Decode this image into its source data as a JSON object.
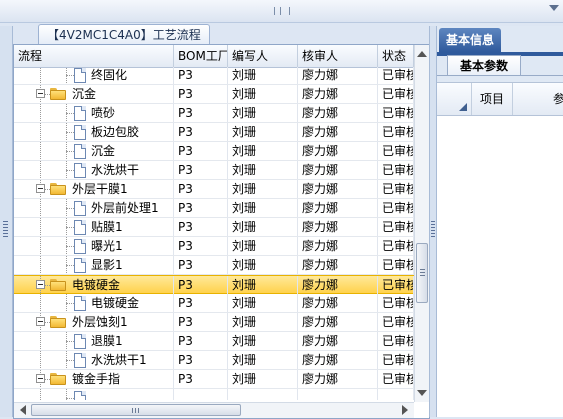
{
  "tab_caption": "【4V2MC1C4A0】工艺流程",
  "columns": [
    "流程",
    "BOM工厂",
    "编写人",
    "核审人",
    "状态"
  ],
  "rows": [
    {
      "level": 2,
      "type": "doc",
      "name": "终固化",
      "bom": "P3",
      "writer": "刘珊",
      "reviewer": "廖力娜",
      "status": "已审核"
    },
    {
      "level": 1,
      "type": "folder",
      "name": "沉金",
      "bom": "P3",
      "writer": "刘珊",
      "reviewer": "廖力娜",
      "status": "已审核"
    },
    {
      "level": 2,
      "type": "doc",
      "name": "喷砂",
      "bom": "P3",
      "writer": "刘珊",
      "reviewer": "廖力娜",
      "status": "已审核"
    },
    {
      "level": 2,
      "type": "doc",
      "name": "板边包胶",
      "bom": "P3",
      "writer": "刘珊",
      "reviewer": "廖力娜",
      "status": "已审核"
    },
    {
      "level": 2,
      "type": "doc",
      "name": "沉金",
      "bom": "P3",
      "writer": "刘珊",
      "reviewer": "廖力娜",
      "status": "已审核"
    },
    {
      "level": 2,
      "type": "doc",
      "name": "水洗烘干",
      "bom": "P3",
      "writer": "刘珊",
      "reviewer": "廖力娜",
      "status": "已审核"
    },
    {
      "level": 1,
      "type": "folder",
      "name": "外层干膜1",
      "bom": "P3",
      "writer": "刘珊",
      "reviewer": "廖力娜",
      "status": "已审核"
    },
    {
      "level": 2,
      "type": "doc",
      "name": "外层前处理1",
      "bom": "P3",
      "writer": "刘珊",
      "reviewer": "廖力娜",
      "status": "已审核"
    },
    {
      "level": 2,
      "type": "doc",
      "name": "贴膜1",
      "bom": "P3",
      "writer": "刘珊",
      "reviewer": "廖力娜",
      "status": "已审核"
    },
    {
      "level": 2,
      "type": "doc",
      "name": "曝光1",
      "bom": "P3",
      "writer": "刘珊",
      "reviewer": "廖力娜",
      "status": "已审核"
    },
    {
      "level": 2,
      "type": "doc",
      "name": "显影1",
      "bom": "P3",
      "writer": "刘珊",
      "reviewer": "廖力娜",
      "status": "已审核"
    },
    {
      "level": 1,
      "type": "folder",
      "name": "电镀硬金",
      "bom": "P3",
      "writer": "刘珊",
      "reviewer": "廖力娜",
      "status": "已审核",
      "selected": true
    },
    {
      "level": 2,
      "type": "doc",
      "name": "电镀硬金",
      "bom": "P3",
      "writer": "刘珊",
      "reviewer": "廖力娜",
      "status": "已审核"
    },
    {
      "level": 1,
      "type": "folder",
      "name": "外层蚀刻1",
      "bom": "P3",
      "writer": "刘珊",
      "reviewer": "廖力娜",
      "status": "已审核"
    },
    {
      "level": 2,
      "type": "doc",
      "name": "退膜1",
      "bom": "P3",
      "writer": "刘珊",
      "reviewer": "廖力娜",
      "status": "已审核"
    },
    {
      "level": 2,
      "type": "doc",
      "name": "水洗烘干1",
      "bom": "P3",
      "writer": "刘珊",
      "reviewer": "廖力娜",
      "status": "已审核"
    },
    {
      "level": 1,
      "type": "folder",
      "name": "镀金手指",
      "bom": "P3",
      "writer": "刘珊",
      "reviewer": "廖力娜",
      "status": "已审核"
    },
    {
      "level": 2,
      "type": "doc",
      "name": "",
      "bom": "",
      "writer": "",
      "reviewer": "",
      "status": ""
    }
  ],
  "right_panel": {
    "tab": "基本信息",
    "subtab": "基本参数",
    "grid_col_item": "项目",
    "grid_col_param": "参"
  },
  "colors": {
    "selection": "#ffd24d",
    "tab_blue": "#2f5a9c"
  }
}
